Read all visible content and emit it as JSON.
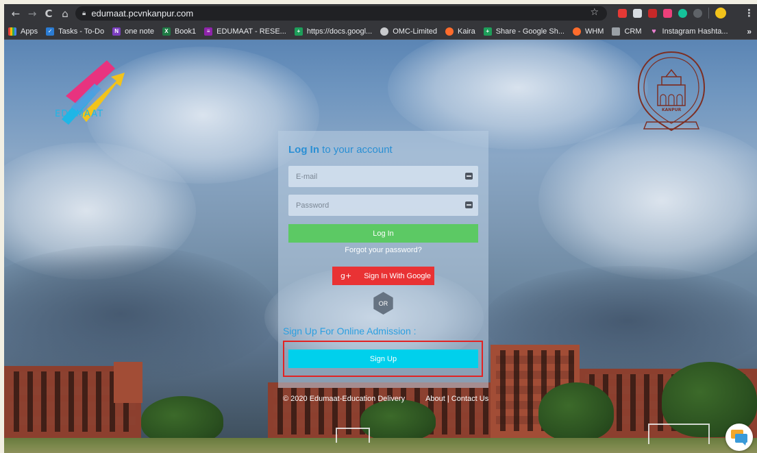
{
  "browser": {
    "url": "edumaat.pcvnkanpur.com",
    "nav": {
      "back": "←",
      "forward": "→",
      "reload": "C",
      "home": "⌂"
    },
    "bookmarks": [
      {
        "label": "Apps",
        "icon": "apps-grid-icon",
        "color": "#e8eaed"
      },
      {
        "label": "Tasks - To-Do",
        "icon": "checkbox-icon",
        "color": "#2b7cd3"
      },
      {
        "label": "one note",
        "icon": "onenote-icon",
        "color": "#7b3fbf"
      },
      {
        "label": "Book1",
        "icon": "excel-icon",
        "color": "#1e7b45"
      },
      {
        "label": "EDUMAAT - RESE...",
        "icon": "list-icon",
        "color": "#8e24aa"
      },
      {
        "label": "https://docs.googl...",
        "icon": "sheets-icon",
        "color": "#1e9e5a"
      },
      {
        "label": "OMC-Limited",
        "icon": "globe-icon",
        "color": "#c8cacd"
      },
      {
        "label": "Kaira",
        "icon": "cpanel-icon",
        "color": "#ff6c2c"
      },
      {
        "label": "Share - Google Sh...",
        "icon": "sheets-icon",
        "color": "#1e9e5a"
      },
      {
        "label": "WHM",
        "icon": "cpanel-icon",
        "color": "#ff6c2c"
      },
      {
        "label": "CRM",
        "icon": "crm-icon",
        "color": "#9aa0a6"
      },
      {
        "label": "Instagram Hashta...",
        "icon": "heart-icon",
        "color": "#e87fd0"
      }
    ],
    "more": "»"
  },
  "brand": {
    "logo_text": "EDUMAAT",
    "seal_text": "KANPUR",
    "colors": {
      "cyan": "#1fb6e6",
      "magenta": "#e8337f",
      "yellow": "#f2c31b"
    }
  },
  "login": {
    "title_bold": "Log In",
    "title_rest": " to your account",
    "email_placeholder": "E-mail",
    "password_placeholder": "Password",
    "login_button": "Log In",
    "forgot": "Forgot your password?",
    "google_icon": "g+",
    "google_button": "Sign In With Google",
    "or": "OR",
    "signup_heading": "Sign Up For Online Admission :",
    "signup_button": "Sign Up"
  },
  "footer": {
    "copyright": "© 2020 Edumaat-Education Delivery",
    "links": "About | Contact Us"
  },
  "colors": {
    "login_green": "#5cc964",
    "google_red": "#e93234",
    "signup_cyan": "#00d0ec",
    "highlight_red": "#e32222",
    "title_blue": "#2a8fd4"
  }
}
